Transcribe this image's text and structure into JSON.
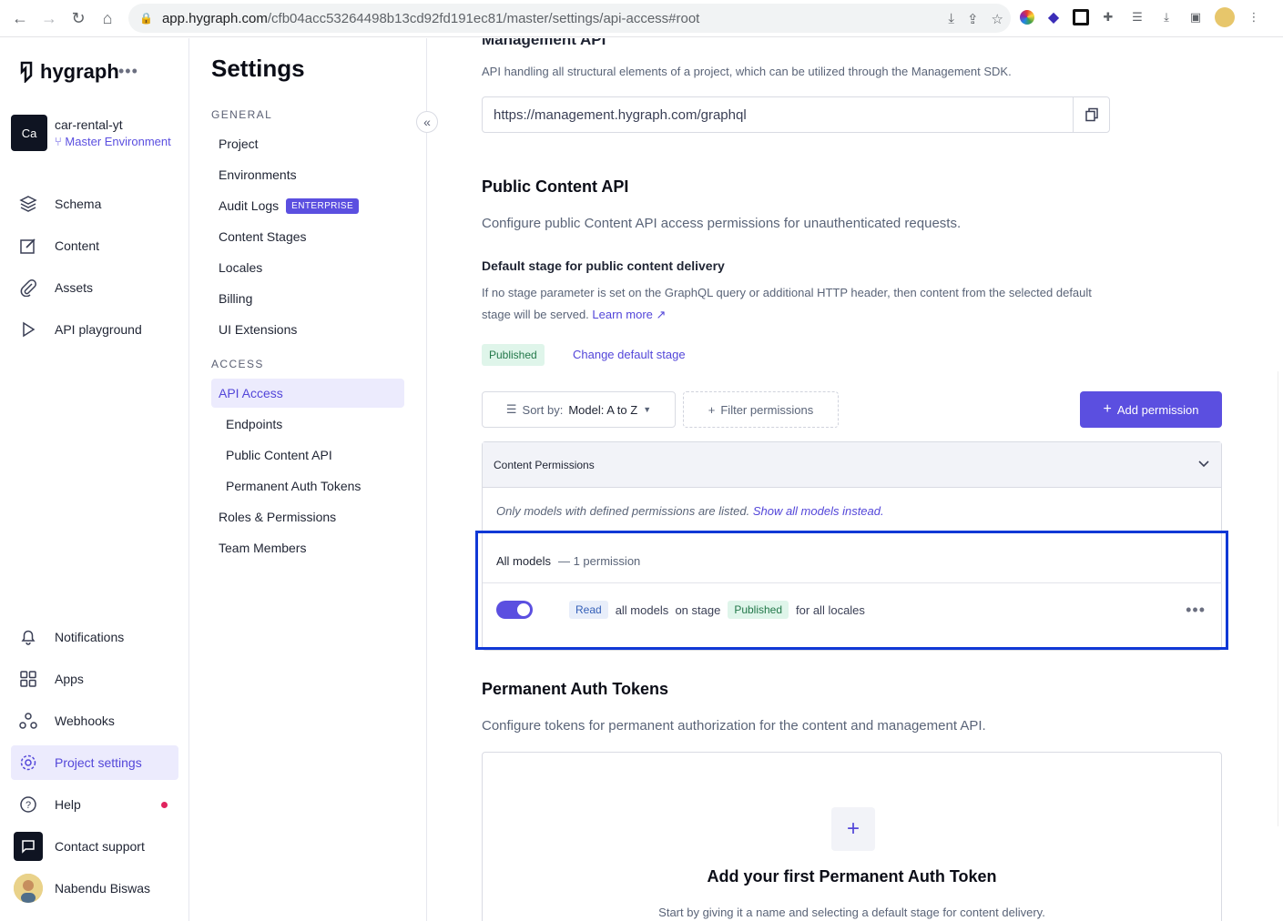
{
  "browser": {
    "url_host": "app.hygraph.com",
    "url_path": "/cfb04acc53264498b13cd92fd191ec81/master/settings/api-access#root"
  },
  "left_nav": {
    "brand": "hygraph",
    "project_initials": "Ca",
    "project_name": "car-rental-yt",
    "environment": "Master Environment",
    "items": [
      {
        "label": "Schema",
        "icon": "layers-icon"
      },
      {
        "label": "Content",
        "icon": "edit-icon"
      },
      {
        "label": "Assets",
        "icon": "paperclip-icon"
      },
      {
        "label": "API playground",
        "icon": "play-icon"
      }
    ],
    "bottom_items": [
      {
        "label": "Notifications",
        "icon": "bell-icon"
      },
      {
        "label": "Apps",
        "icon": "apps-grid-icon"
      },
      {
        "label": "Webhooks",
        "icon": "webhook-icon"
      },
      {
        "label": "Project settings",
        "icon": "gear-icon"
      },
      {
        "label": "Help",
        "icon": "help-icon"
      },
      {
        "label": "Contact support",
        "icon": "chat-icon"
      }
    ],
    "user_name": "Nabendu Biswas"
  },
  "settings": {
    "title": "Settings",
    "general_heading": "GENERAL",
    "general_items": [
      "Project",
      "Environments",
      "Audit Logs",
      "Content Stages",
      "Locales",
      "Billing",
      "UI Extensions"
    ],
    "enterprise_badge": "ENTERPRISE",
    "access_heading": "ACCESS",
    "access_items": [
      "API Access",
      "Endpoints",
      "Public Content API",
      "Permanent Auth Tokens",
      "Roles & Permissions",
      "Team Members"
    ]
  },
  "main": {
    "management_title": "Management API",
    "management_desc": "API handling all structural elements of a project, which can be utilized through the Management SDK.",
    "management_url": "https://management.hygraph.com/graphql",
    "public_title": "Public Content API",
    "public_desc": "Configure public Content API access permissions for unauthenticated requests.",
    "default_stage_title": "Default stage for public content delivery",
    "default_stage_desc": "If no stage parameter is set on the GraphQL query or additional HTTP header, then content from the selected default stage will be served.",
    "learn_more": "Learn more",
    "stage_badge": "Published",
    "change_stage": "Change default stage",
    "sort_prefix": "Sort by:",
    "sort_value": "Model: A to Z",
    "filter_label": "Filter permissions",
    "add_permission": "Add permission",
    "content_permissions": "Content Permissions",
    "models_note": "Only models with defined permissions are listed.",
    "show_all": "Show all models instead.",
    "all_models": "All models",
    "permission_count": "— 1 permission",
    "perm_action": "Read",
    "perm_models": "all models",
    "perm_on_stage": "on stage",
    "perm_stage": "Published",
    "perm_locales": "for all locales",
    "tokens_title": "Permanent Auth Tokens",
    "tokens_desc": "Configure tokens for permanent authorization for the content and management API.",
    "tokens_empty_title": "Add your first Permanent Auth Token",
    "tokens_empty_desc": "Start by giving it a name and selecting a default stage for content delivery."
  }
}
